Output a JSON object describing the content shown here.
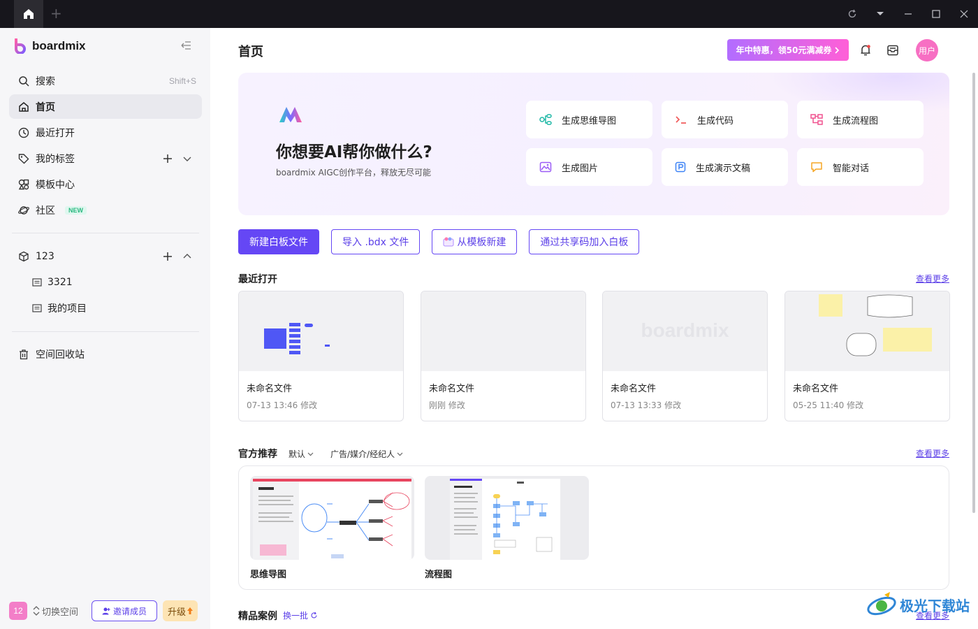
{
  "titlebar": {
    "new_tab": "+"
  },
  "sidebar": {
    "brand": "boardmix",
    "search": {
      "label": "搜索",
      "shortcut": "Shift+S"
    },
    "nav": [
      {
        "label": "首页",
        "icon": "home-icon",
        "active": true
      },
      {
        "label": "最近打开",
        "icon": "clock-icon"
      },
      {
        "label": "我的标签",
        "icon": "tag-icon"
      },
      {
        "label": "模板中心",
        "icon": "template-icon"
      },
      {
        "label": "社区",
        "icon": "planet-icon",
        "badge": "NEW"
      }
    ],
    "team": {
      "label": "123",
      "children": [
        "3321",
        "我的项目"
      ]
    },
    "trash": "空间回收站",
    "footer": {
      "space_number": "12",
      "switch": "切换空间",
      "invite": "邀请成员",
      "upgrade": "升级"
    }
  },
  "header": {
    "title": "首页",
    "promo": "年中特惠，领50元满减券",
    "user": "用户"
  },
  "ai": {
    "title": "你想要AI帮你做什么?",
    "subtitle": "boardmix AIGC创作平台，释放无尽可能",
    "actions": [
      {
        "label": "生成思维导图",
        "icon": "mindmap-icon",
        "color": "#1fb8a6"
      },
      {
        "label": "生成代码",
        "icon": "code-icon",
        "color": "#f05a5a"
      },
      {
        "label": "生成流程图",
        "icon": "flowchart-icon",
        "color": "#f0528f"
      },
      {
        "label": "生成图片",
        "icon": "image-icon",
        "color": "#9b5cf6"
      },
      {
        "label": "生成演示文稿",
        "icon": "presentation-icon",
        "color": "#3b82f6"
      },
      {
        "label": "智能对话",
        "icon": "chat-icon",
        "color": "#f5a524"
      }
    ]
  },
  "buttons": {
    "new_board": "新建白板文件",
    "import": "导入 .bdx 文件",
    "from_template": "从模板新建",
    "join_code": "通过共享码加入白板"
  },
  "recent": {
    "title": "最近打开",
    "see_more": "查看更多",
    "files": [
      {
        "name": "未命名文件",
        "time": "07-13 13:46 修改"
      },
      {
        "name": "未命名文件",
        "time": "刚刚 修改"
      },
      {
        "name": "未命名文件",
        "time": "07-13 13:33 修改",
        "thumb_text": "boardmix"
      },
      {
        "name": "未命名文件",
        "time": "05-25 11:40 修改"
      }
    ]
  },
  "official": {
    "title": "官方推荐",
    "filter_sort": "默认",
    "filter_category": "广告/媒介/经纪人",
    "see_more": "查看更多",
    "items": [
      {
        "label": "思维导图"
      },
      {
        "label": "流程图"
      }
    ]
  },
  "cases": {
    "title": "精品案例",
    "refresh": "换一批",
    "see_more": "查看更多"
  },
  "watermark": "极光下载站",
  "colors": {
    "accent": "#6547f5",
    "sidebar_bg": "#f6f6f8",
    "titlebar_bg": "#17161c"
  }
}
